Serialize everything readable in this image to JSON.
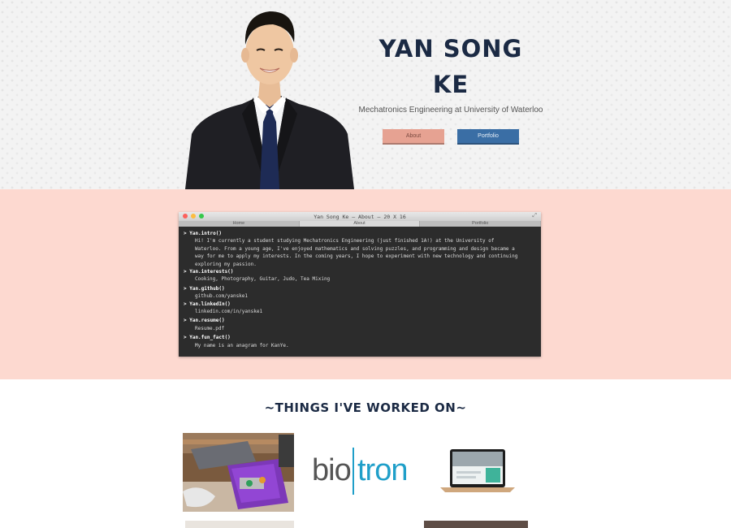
{
  "hero": {
    "name_line1": "YAN SONG",
    "name_line2": "KE",
    "subtitle": "Mechatronics Engineering at University of Waterloo",
    "about_button": "About",
    "portfolio_button": "Portfolio"
  },
  "terminal": {
    "title": "Yan Song Ke — About — 20 X 16",
    "tabs": [
      "Home",
      "About",
      "Portfolio"
    ],
    "entries": [
      {
        "cmd": "> Yan.intro()",
        "out": [
          "Hi! I'm currently a student studying Mechatronics Engineering (just finished 1A!) at the University of",
          "Waterloo. From a young age, I've enjoyed mathematics and solving puzzles, and programming and design became a",
          "way for me to apply my interests. In the coming years, I hope to experiment with new technology and continuing",
          "exploring my passion."
        ]
      },
      {
        "cmd": "> Yan.interests()",
        "out": [
          "Cooking, Photography, Guitar, Judo, Tea Mixing"
        ]
      },
      {
        "cmd": "> Yan.github()",
        "out": [
          "github.com/yanske1"
        ]
      },
      {
        "cmd": "> Yan.linkedIn()",
        "out": [
          "linkedin.com/in/yanske1"
        ]
      },
      {
        "cmd": "> Yan.resume()",
        "out": [
          "Resume.pdf"
        ]
      },
      {
        "cmd": "> Yan.fun_fact()",
        "out": [
          "My name is an anagram for KanYe."
        ]
      }
    ]
  },
  "work": {
    "title": "~THINGS I'VE WORKED ON~",
    "biotron_logo": "biotron"
  },
  "colors": {
    "navy": "#1b2a44",
    "about_band": "#fdd9d0",
    "about_button": "#e6a292",
    "portfolio_button": "#3a6ea5",
    "biotron_left": "#555555",
    "biotron_right": "#1f9fc9"
  }
}
